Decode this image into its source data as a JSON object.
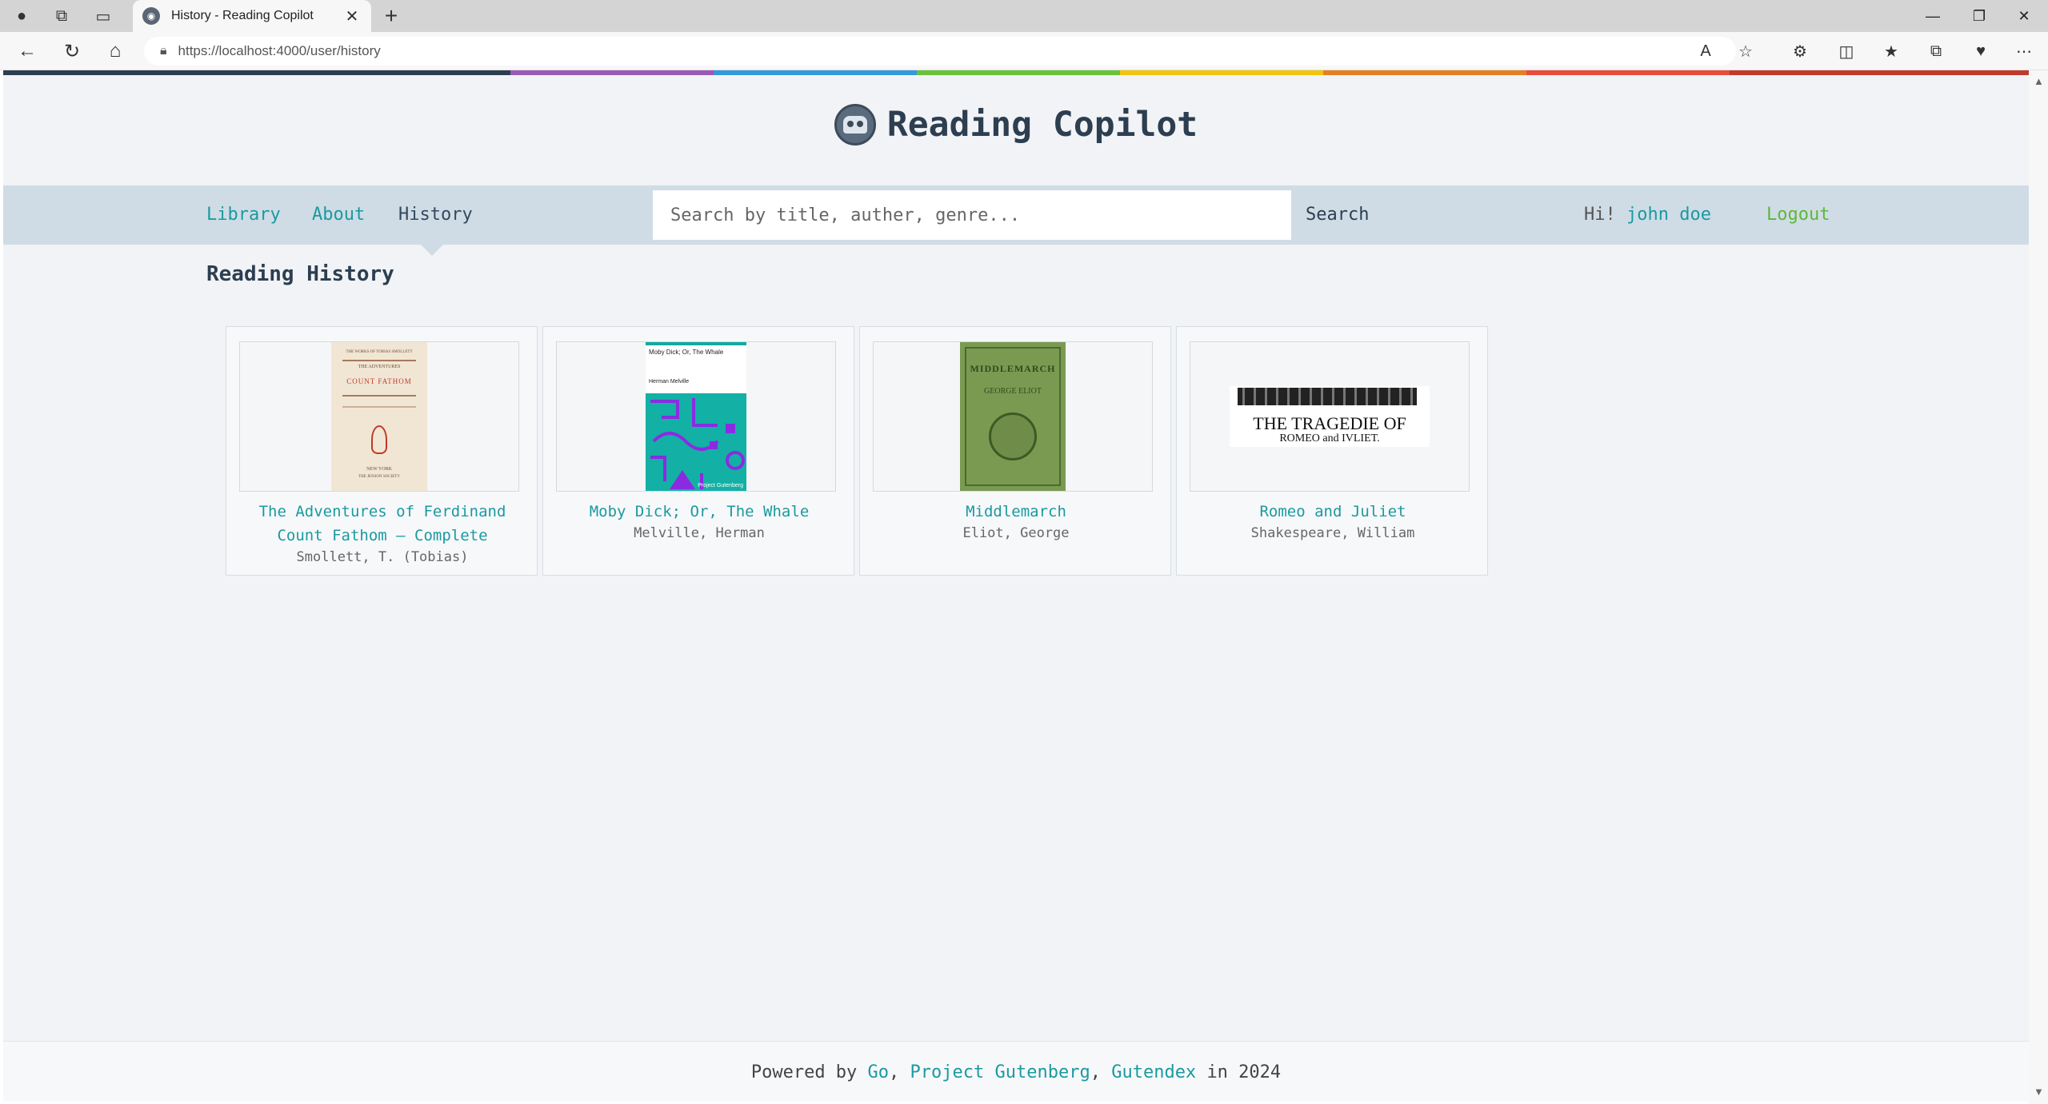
{
  "browser": {
    "tab_title": "History - Reading Copilot",
    "url": "https://localhost:4000/user/history"
  },
  "site": {
    "title": "Reading Copilot",
    "rainbow_colors": [
      "#2c3e50",
      "#9b59b6",
      "#3498db",
      "#6bc139",
      "#f1c40f",
      "#e67e22",
      "#e74c3c",
      "#c0392b"
    ]
  },
  "nav": {
    "library": "Library",
    "about": "About",
    "history": "History",
    "search_placeholder": "Search by title, auther, genre...",
    "search_label": "Search",
    "greeting": "Hi!",
    "username": "john doe",
    "logout": "Logout"
  },
  "section_title": "Reading History",
  "books": [
    {
      "title": "The Adventures of Ferdinand Count Fathom — Complete",
      "author": "Smollett, T. (Tobias)",
      "cover": {
        "line1": "THE WORKS OF TOBIAS SMOLLETT",
        "line2": "THE ADVENTURES",
        "line3": "COUNT FATHOM",
        "line4": "NEW YORK",
        "line5": "THE JENSON SOCIETY"
      }
    },
    {
      "title": "Moby Dick; Or, The Whale",
      "author": "Melville, Herman",
      "cover": {
        "line1": "Moby Dick; Or, The Whale",
        "line2": "Herman Melville",
        "line3": "Project Gutenberg"
      }
    },
    {
      "title": "Middlemarch",
      "author": "Eliot, George",
      "cover": {
        "line1": "MIDDLEMARCH",
        "line2": "GEORGE ELIOT"
      }
    },
    {
      "title": "Romeo and Juliet",
      "author": "Shakespeare, William",
      "cover": {
        "line1": "THE TRAGEDIE OF",
        "line2": "ROMEO and IVLIET."
      }
    }
  ],
  "footer": {
    "powered": "Powered by",
    "go": "Go",
    "sep1": ",",
    "pg": "Project Gutenberg",
    "sep2": ",",
    "gutendex": "Gutendex",
    "year_text": "in 2024"
  }
}
